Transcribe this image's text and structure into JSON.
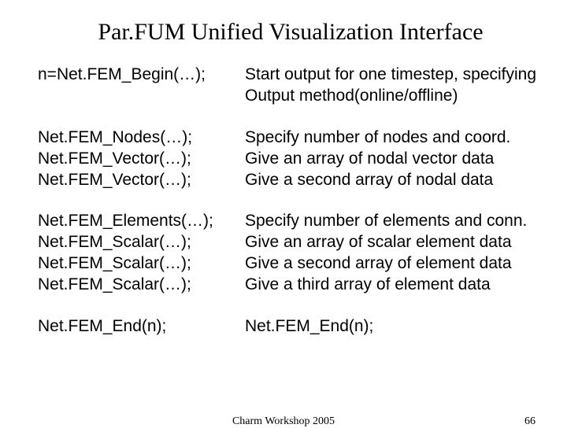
{
  "title": "Par.FUM Unified Visualization Interface",
  "rows": [
    {
      "api": [
        "n=Net.FEM_Begin(…);"
      ],
      "desc": [
        "Start output for one timestep, specifying",
        "Output method(online/offline)"
      ]
    },
    {
      "api": [
        "Net.FEM_Nodes(…);",
        "Net.FEM_Vector(…);",
        "Net.FEM_Vector(…);"
      ],
      "desc": [
        "Specify number of nodes and coord.",
        "Give an array of nodal vector data",
        "Give a second array of nodal data"
      ]
    },
    {
      "api": [
        "Net.FEM_Elements(…);",
        "Net.FEM_Scalar(…);",
        "Net.FEM_Scalar(…);",
        "Net.FEM_Scalar(…);"
      ],
      "desc": [
        "Specify number of elements and conn.",
        "Give an array of scalar element data",
        "Give a second array of element data",
        "Give a third array of element data"
      ]
    },
    {
      "api": [
        "Net.FEM_End(n);"
      ],
      "desc": [
        "Net.FEM_End(n);"
      ]
    }
  ],
  "footer": {
    "center": "Charm Workshop 2005",
    "page": "66"
  }
}
